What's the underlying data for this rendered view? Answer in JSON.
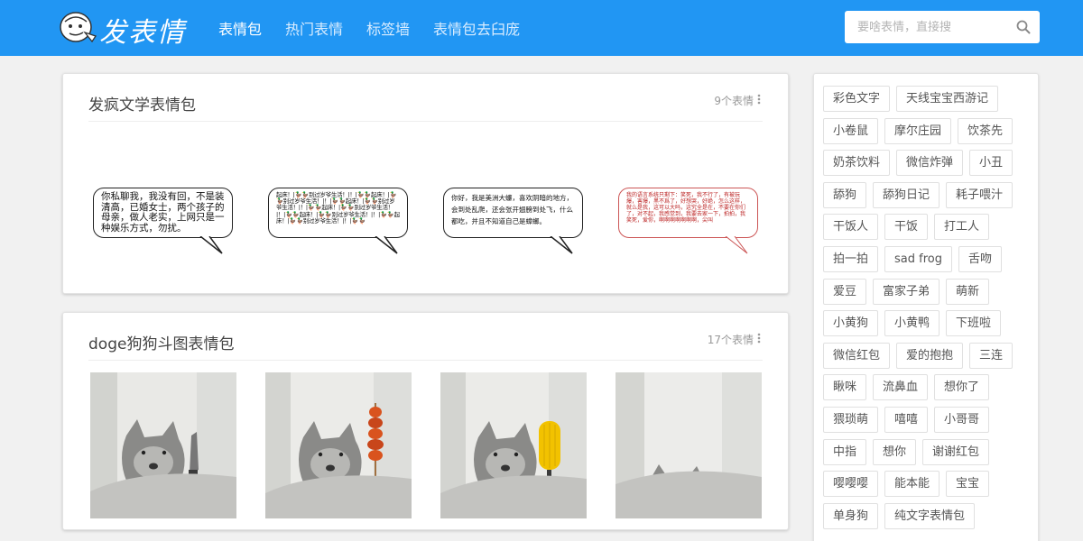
{
  "header": {
    "logo_text": "发表情",
    "nav": [
      {
        "label": "表情包",
        "active": true
      },
      {
        "label": "热门表情",
        "active": false
      },
      {
        "label": "标签墙",
        "active": false
      },
      {
        "label": "表情包去臼庞",
        "active": false
      }
    ],
    "search": {
      "placeholder": "要啥表情，直接搜",
      "value": ""
    },
    "colors": {
      "brand": "#2196f3"
    }
  },
  "sections": [
    {
      "title": "发疯文学表情包",
      "count": "9个表情",
      "items": [
        {
          "type": "bubble",
          "text": "你私聊我，我没有回，不是装清高，已婚女士，两个孩子的母亲，做人老实，上网只是一种娱乐方式，勿扰。"
        },
        {
          "type": "bubble",
          "text": "起床！|🦆🦆别过岁爷生活！|！|🦆🦆起床！|🦆🦆别过岁爷生活！|！|🦆🦆起床！|🦆🦆别过岁爷生活！|！|🦆🦆起床！|🦆🦆别过岁爷生活！|！|🦆🦆起床！|🦆🦆别过岁爷生活！|！|🦆🦆起床！|🦆🦆别过岁爷生活！|！|🦆🦆"
        },
        {
          "type": "bubble",
          "text": "你好，我是美洲大蠊，喜欢阴暗的地方，会到处乱爬，还会张开翅膀到处飞，什么都吃，并且不知道自己是蟑螂。"
        },
        {
          "type": "bubble",
          "text": "我的语言系统只剩下：笑死，我不行了，有被玩爆，害爆，黑不爲了，好想哭，好绝，怎么这样，就么是我，这可以大吗，这究全是在，不要在你们了，对不起，我感觉到，我要去家一下，拍拍，我笑死，爱你，啊啊啊啊啊啊啊，尖叫"
        }
      ]
    },
    {
      "title": "doge狗狗斗图表情包",
      "count": "17个表情",
      "items": [
        {
          "type": "photo",
          "prop": "knife-icon"
        },
        {
          "type": "photo",
          "prop": "skewer-icon"
        },
        {
          "type": "photo",
          "prop": "corn-icon"
        },
        {
          "type": "photo",
          "prop": "ears-icon"
        }
      ]
    }
  ],
  "sidebar": {
    "tags": [
      "彩色文字",
      "天线宝宝西游记",
      "小卷鼠",
      "摩尔庄园",
      "饮茶先",
      "奶茶饮料",
      "微信炸弹",
      "小丑",
      "舔狗",
      "舔狗日记",
      "耗子喂汁",
      "干饭人",
      "干饭",
      "打工人",
      "拍一拍",
      "sad frog",
      "舌吻",
      "爱豆",
      "富家子弟",
      "萌新",
      "小黄狗",
      "小黄鸭",
      "下班啦",
      "微信红包",
      "爱的抱抱",
      "三连",
      "瞅咪",
      "流鼻血",
      "想你了",
      "猥琐萌",
      "嘻嘻",
      "小哥哥",
      "中指",
      "想你",
      "谢谢红包",
      "嘤嘤嘤",
      "能本能",
      "宝宝",
      "单身狗",
      "纯文字表情包"
    ]
  }
}
